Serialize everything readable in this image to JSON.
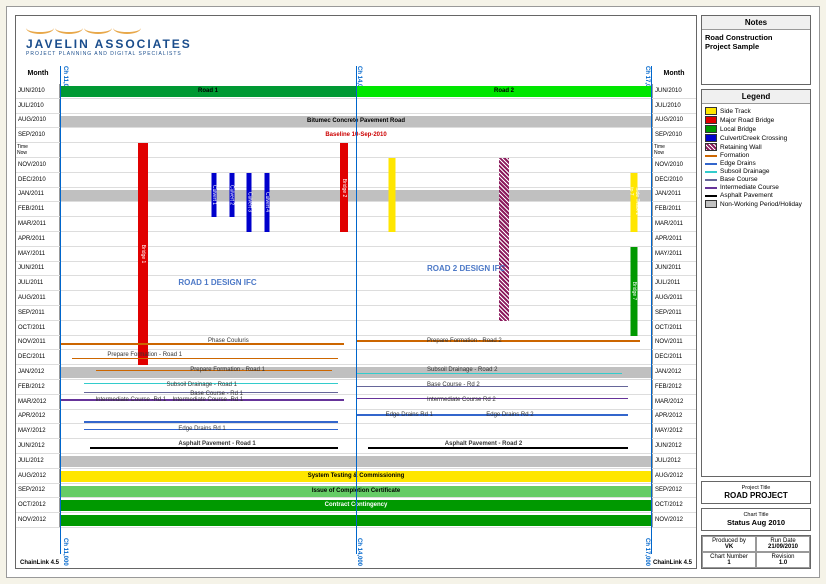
{
  "logo": {
    "name": "JAVELIN ASSOCIATES",
    "sub": "PROJECT PLANNING AND DIGITAL SPECIALISTS"
  },
  "monthHdr": "Month",
  "months": [
    "JUN/2010",
    "JUL/2010",
    "AUG/2010",
    "SEP/2010",
    "OCT/2010",
    "NOV/2010",
    "DEC/2010",
    "JAN/2011",
    "FEB/2011",
    "MAR/2011",
    "APR/2011",
    "MAY/2011",
    "JUN/2011",
    "JUL/2011",
    "AUG/2011",
    "SEP/2011",
    "OCT/2011",
    "NOV/2011",
    "DEC/2011",
    "JAN/2012",
    "FEB/2012",
    "MAR/2012",
    "APR/2012",
    "MAY/2012",
    "JUN/2012",
    "JUL/2012",
    "AUG/2012",
    "SEP/2012",
    "OCT/2012",
    "NOV/2012"
  ],
  "chainages": [
    "Ch 11,000",
    "Ch 14,000",
    "Ch 17,000"
  ],
  "chainlink": "ChainLink 4.5",
  "timeLabels": [
    "Time",
    "Now"
  ],
  "notes": {
    "hdr": "Notes",
    "lines": [
      "Road Construction",
      "Project Sample"
    ]
  },
  "legend": {
    "hdr": "Legend",
    "items": [
      {
        "t": "sw",
        "c": "#ffe600",
        "n": "Side Track"
      },
      {
        "t": "sw",
        "c": "#e00000",
        "n": "Major Road Bridge"
      },
      {
        "t": "sw",
        "c": "#009900",
        "n": "Local Bridge"
      },
      {
        "t": "sw",
        "c": "#0000cc",
        "n": "Culvert/Creek Crossing"
      },
      {
        "t": "sw",
        "c": "#8b1a5c",
        "hatch": true,
        "n": "Retaining Wall"
      },
      {
        "t": "ln",
        "c": "#cc6600",
        "n": "Formation"
      },
      {
        "t": "ln",
        "c": "#3366cc",
        "n": "Edge Drains"
      },
      {
        "t": "ln",
        "c": "#33cccc",
        "n": "Subsoil Drainage"
      },
      {
        "t": "ln",
        "c": "#666699",
        "n": "Base Course"
      },
      {
        "t": "ln",
        "c": "#663399",
        "n": "Intermediate Course"
      },
      {
        "t": "ln",
        "c": "#000",
        "n": "Asphalt Pavement"
      },
      {
        "t": "sw",
        "c": "#c0c0c0",
        "n": "Non-Working Period/Holiday"
      }
    ]
  },
  "proj": {
    "hdr": "Project Title",
    "v": "ROAD PROJECT"
  },
  "ctitle": {
    "hdr": "Chart Title",
    "v": "Status Aug 2010"
  },
  "meta": {
    "pb": "Produced by",
    "pbv": "VK",
    "rd": "Run Date",
    "rdv": "21/09/2010",
    "cn": "Chart Number",
    "cnv": "1",
    "rv": "Revision",
    "rvv": "1.0"
  },
  "labels": {
    "road1": "Road 1",
    "road2": "Road 2",
    "bitumec": "Bitumec Concrete Pavement Road",
    "baseline": "Baseline 10-Sep-2010",
    "r1ifc": "ROAD 1 DESIGN IFC",
    "r2ifc": "ROAD 2 DESIGN IFC",
    "phaseC": "Phase Couluris",
    "prepF2": "Prepare Formation - Road 2",
    "prepF1a": "Prepare Formation - Road 1",
    "prepF1b": "Prepare Formation - Road 1",
    "sd1": "Subsoil Drainage - Road 1",
    "sd2": "Subsoil Drainage - Road 2",
    "bc1": "Base Course - Rd 1",
    "bc2": "Base Course - Rd 2",
    "ic1": "Intermediate Course -Rd 1",
    "ic1b": "Intermediate Course -Rd 1",
    "ic2": "Intermediate Course Rd 2",
    "ed1": "Edge Drains Rd 1",
    "ed1b": "Edge Drains Rd 1",
    "ed2": "Edge Drains Rd 2",
    "ap1": "Asphalt Pavement - Road 1",
    "ap2": "Asphalt Pavement - Road 2",
    "syst": "System Testing & Commissioning",
    "issue": "Issue of Completion Certificate",
    "contract": "Contract Contingency",
    "bridge1": "Bridge 1",
    "bridge2": "Bridge 2",
    "bridge7": "Bridge 7",
    "culvert1": "Culvert 1",
    "culvert2": "Culvert 2",
    "culvert3": "Culvert 3",
    "culvert4": "Culvert 4",
    "sidetrack": "Side Track 1 to 7"
  },
  "chart_data": {
    "type": "gantt-location",
    "title": "Status Aug 2010",
    "time_axis": {
      "start": "2010-06",
      "end": "2012-11",
      "unit": "month"
    },
    "location_axis": {
      "start": 11000,
      "end": 17000,
      "unit": "chainage",
      "markers": [
        11000,
        14000,
        17000
      ]
    },
    "baseline_date": "2010-09-10",
    "time_now": "2010-10",
    "roads": [
      {
        "name": "Road 1",
        "ch": [
          11000,
          14000
        ]
      },
      {
        "name": "Road 2",
        "ch": [
          14000,
          17000
        ]
      }
    ],
    "non_working": [
      "2011-01",
      "2012-01",
      "2012-07"
    ],
    "design_ifc": [
      {
        "name": "ROAD 1 DESIGN IFC",
        "month": "2011-07",
        "ch": [
          11000,
          14000
        ]
      },
      {
        "name": "ROAD 2 DESIGN IFC",
        "month": "2011-06",
        "ch": [
          14000,
          17000
        ]
      }
    ],
    "spanning_tasks": [
      {
        "name": "Bitumec Concrete Pavement Road",
        "months": [
          "2010-08",
          "2010-08"
        ],
        "ch": [
          11000,
          17000
        ],
        "color": "#c0c0c0"
      },
      {
        "name": "System Testing & Commissioning",
        "months": [
          "2012-08",
          "2012-08"
        ],
        "ch": [
          11000,
          17000
        ],
        "color": "#ffe600"
      },
      {
        "name": "Issue of Completion Certificate",
        "months": [
          "2012-09",
          "2012-09"
        ],
        "ch": [
          11000,
          17000
        ],
        "color": "#66cc66"
      },
      {
        "name": "Contract Contingency",
        "months": [
          "2012-10",
          "2012-11"
        ],
        "ch": [
          11000,
          17000
        ],
        "color": "#009900"
      }
    ],
    "vertical_tasks": [
      {
        "name": "Bridge 1",
        "type": "Major Road Bridge",
        "ch": 11900,
        "months": [
          "2010-10",
          "2012-01"
        ]
      },
      {
        "name": "Culvert 1",
        "type": "Culvert/Creek Crossing",
        "ch": 12600,
        "months": [
          "2010-12",
          "2011-03"
        ]
      },
      {
        "name": "Culvert 2",
        "type": "Culvert/Creek Crossing",
        "ch": 12800,
        "months": [
          "2010-12",
          "2011-03"
        ]
      },
      {
        "name": "Culvert 3",
        "type": "Culvert/Creek Crossing",
        "ch": 13000,
        "months": [
          "2010-12",
          "2011-04"
        ]
      },
      {
        "name": "Culvert 4",
        "type": "Culvert/Creek Crossing",
        "ch": 13200,
        "months": [
          "2010-12",
          "2011-04"
        ]
      },
      {
        "name": "Bridge 2",
        "type": "Major Road Bridge",
        "ch": 13900,
        "months": [
          "2010-10",
          "2011-04"
        ]
      },
      {
        "name": "Side Track",
        "type": "Side Track",
        "ch": 14500,
        "months": [
          "2010-11",
          "2011-04"
        ]
      },
      {
        "name": "Retaining Wall",
        "type": "Retaining Wall",
        "ch": 15600,
        "months": [
          "2010-11",
          "2011-10"
        ]
      },
      {
        "name": "Side Track 1 to 7",
        "type": "Side Track",
        "ch": 16900,
        "months": [
          "2010-12",
          "2011-04"
        ]
      },
      {
        "name": "Bridge 7",
        "type": "Local Bridge",
        "ch": 16900,
        "months": [
          "2011-05",
          "2011-11"
        ]
      }
    ],
    "linear_tasks": [
      {
        "name": "Prepare Formation - Road 1",
        "type": "Formation",
        "ch": [
          11000,
          13800
        ],
        "months": [
          "2011-12",
          "2012-01"
        ]
      },
      {
        "name": "Prepare Formation - Road 2",
        "type": "Formation",
        "ch": [
          14000,
          16800
        ],
        "months": [
          "2011-11",
          "2011-11"
        ]
      },
      {
        "name": "Subsoil Drainage - Road 1",
        "type": "Subsoil Drainage",
        "ch": [
          11200,
          13800
        ],
        "months": [
          "2012-02",
          "2012-02"
        ]
      },
      {
        "name": "Subsoil Drainage - Road 2",
        "type": "Subsoil Drainage",
        "ch": [
          14000,
          16500
        ],
        "months": [
          "2012-01",
          "2012-01"
        ]
      },
      {
        "name": "Base Course - Rd 1",
        "type": "Base Course",
        "ch": [
          11200,
          13800
        ],
        "months": [
          "2012-02",
          "2012-03"
        ]
      },
      {
        "name": "Base Course - Rd 2",
        "type": "Base Course",
        "ch": [
          14000,
          16800
        ],
        "months": [
          "2012-02",
          "2012-02"
        ]
      },
      {
        "name": "Intermediate Course -Rd 1",
        "type": "Intermediate Course",
        "ch": [
          11000,
          13800
        ],
        "months": [
          "2012-03",
          "2012-03"
        ]
      },
      {
        "name": "Intermediate Course Rd 2",
        "type": "Intermediate Course",
        "ch": [
          14000,
          16800
        ],
        "months": [
          "2012-03",
          "2012-03"
        ]
      },
      {
        "name": "Edge Drains Rd 1",
        "type": "Edge Drains",
        "ch": [
          11200,
          13800
        ],
        "months": [
          "2012-04",
          "2012-05"
        ]
      },
      {
        "name": "Edge Drains Rd 2",
        "type": "Edge Drains",
        "ch": [
          14000,
          16800
        ],
        "months": [
          "2012-04",
          "2012-04"
        ]
      },
      {
        "name": "Asphalt Pavement - Road 1",
        "type": "Asphalt Pavement",
        "ch": [
          11300,
          13800
        ],
        "months": [
          "2012-06",
          "2012-06"
        ]
      },
      {
        "name": "Asphalt Pavement - Road 2",
        "type": "Asphalt Pavement",
        "ch": [
          14100,
          16800
        ],
        "months": [
          "2012-06",
          "2012-06"
        ]
      }
    ]
  }
}
